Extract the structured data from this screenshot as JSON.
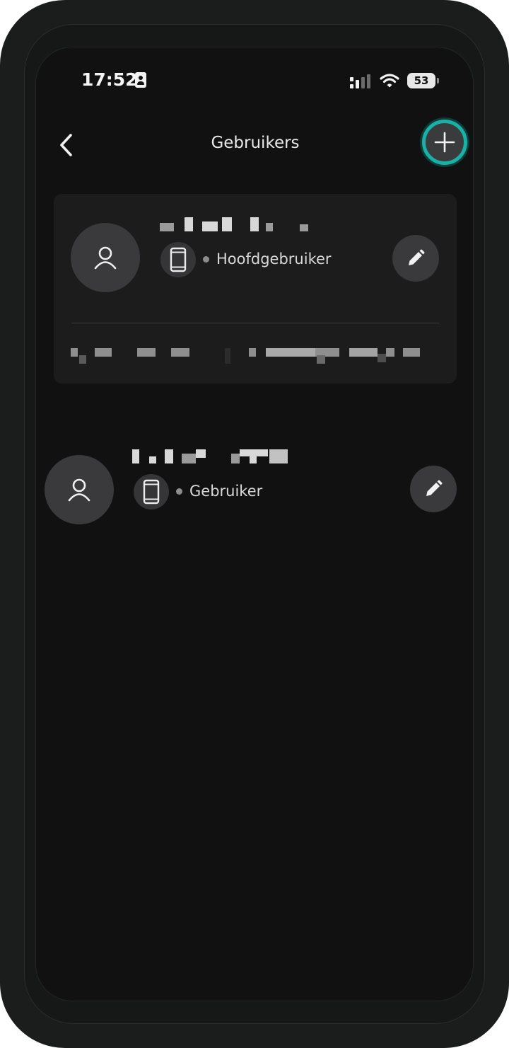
{
  "status_bar": {
    "time": "17:52",
    "battery": "53",
    "icons": [
      "contact-card-icon",
      "signal-icon",
      "wifi-icon",
      "battery-icon"
    ]
  },
  "header": {
    "title": "Gebruikers",
    "back_icon": "chevron-left-icon",
    "add_icon": "plus-icon",
    "accent_color": "#1bb0a6"
  },
  "users": [
    {
      "role": "Hoofdgebruiker",
      "device_icon": "smartphone-icon",
      "avatar_icon": "person-icon",
      "edit_icon": "pencil-icon"
    },
    {
      "role": "Gebruiker",
      "device_icon": "smartphone-icon",
      "avatar_icon": "person-icon",
      "edit_icon": "pencil-icon"
    }
  ]
}
